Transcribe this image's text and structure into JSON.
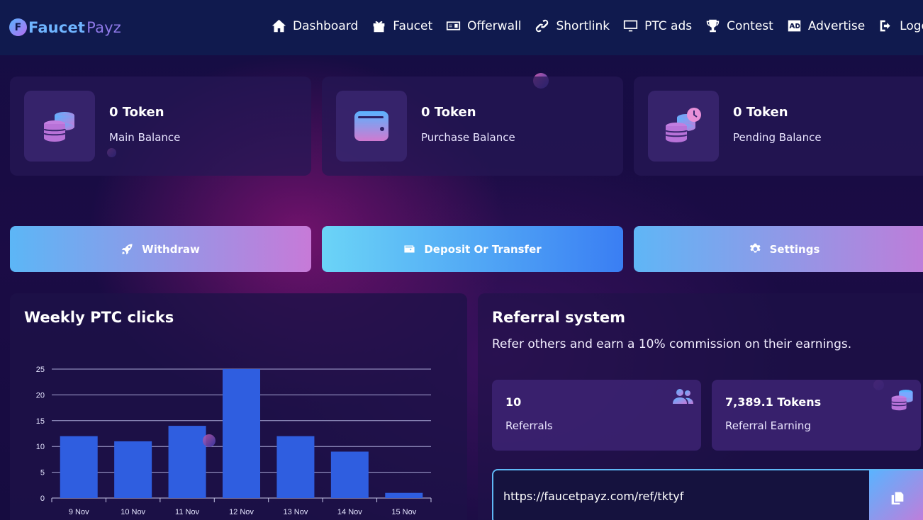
{
  "brand": {
    "name_part1": "Faucet",
    "name_part2": "Payz",
    "logo_letter": "F"
  },
  "nav": [
    {
      "label": "Dashboard",
      "icon": "home-icon"
    },
    {
      "label": "Faucet",
      "icon": "gift-icon"
    },
    {
      "label": "Offerwall",
      "icon": "money-bill-icon"
    },
    {
      "label": "Shortlink",
      "icon": "link-icon"
    },
    {
      "label": "PTC ads",
      "icon": "monitor-icon"
    },
    {
      "label": "Contest",
      "icon": "trophy-icon"
    },
    {
      "label": "Advertise",
      "icon": "ad-icon"
    },
    {
      "label": "Logo",
      "icon": "logout-icon"
    }
  ],
  "balances": [
    {
      "value": "0 Token",
      "label": "Main Balance",
      "icon": "coins-icon"
    },
    {
      "value": "0 Token",
      "label": "Purchase Balance",
      "icon": "wallet-icon"
    },
    {
      "value": "0 Token",
      "label": "Pending Balance",
      "icon": "coins-clock-icon"
    }
  ],
  "actions": {
    "withdraw": "Withdraw",
    "deposit": "Deposit Or Transfer",
    "settings": "Settings"
  },
  "chart_panel": {
    "title": "Weekly PTC clicks"
  },
  "referral": {
    "title": "Referral system",
    "description": "Refer others and earn a 10% commission on their earnings.",
    "stats": [
      {
        "value": "10",
        "label": "Referrals",
        "icon": "users-icon"
      },
      {
        "value": "7,389.1 Tokens",
        "label": "Referral Earning",
        "icon": "coins-icon"
      }
    ],
    "link": "https://faucetpayz.com/ref/tktyf"
  },
  "colors": {
    "navbar": "#101a4e",
    "bar": "#2f5ee0",
    "accent_blue": "#5ab3ff",
    "accent_pink": "#c67ad8"
  },
  "chart_data": {
    "type": "bar",
    "title": "",
    "xlabel": "",
    "ylabel": "",
    "categories": [
      "9 Nov",
      "10 Nov",
      "11 Nov",
      "12 Nov",
      "13 Nov",
      "14 Nov",
      "15 Nov"
    ],
    "values": [
      12,
      11,
      14,
      25,
      12,
      9,
      1
    ],
    "ylim": [
      0,
      25
    ],
    "yticks": [
      0,
      5,
      10,
      15,
      20,
      25
    ],
    "grid": true,
    "legend": "none"
  }
}
